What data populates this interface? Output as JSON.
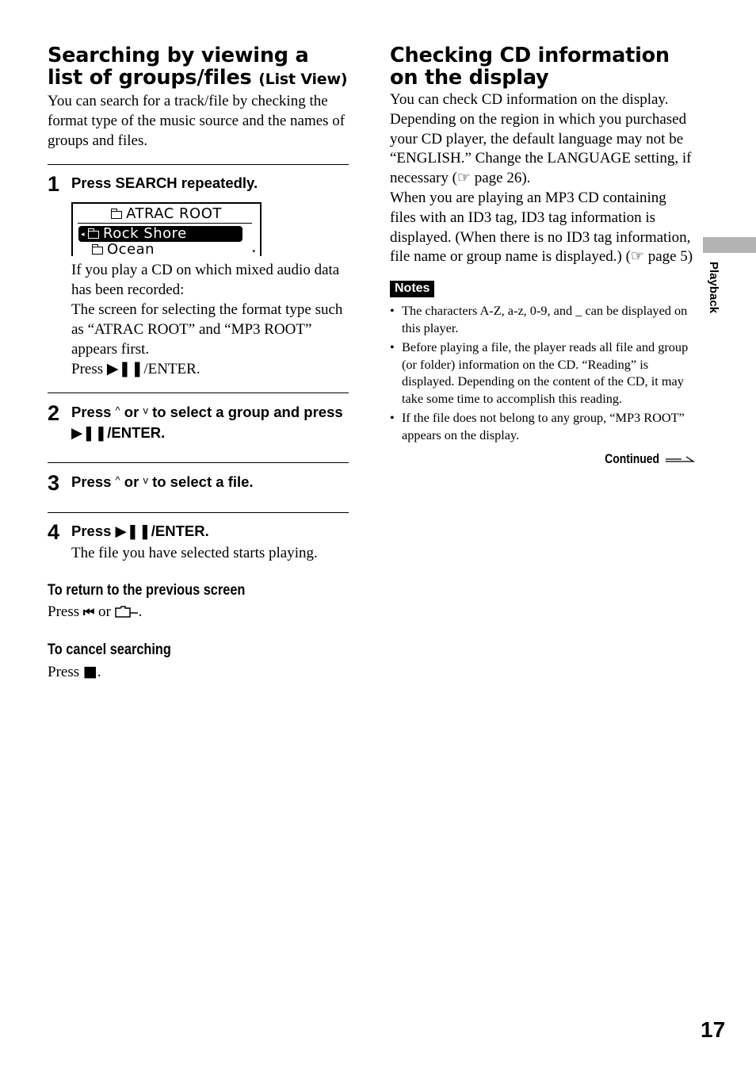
{
  "page_number": "17",
  "side_tab": {
    "label": "Playback",
    "color": "#b3b3b3"
  },
  "left": {
    "title_main": "Searching by viewing a list of groups/files",
    "title_sub": "(List View)",
    "intro": "You can search for a track/file by checking the format type of the music source and the names of groups and files.",
    "steps": [
      {
        "number": "1",
        "title": "Press SEARCH repeatedly.",
        "display": {
          "header": "ATRAC ROOT",
          "selected": "Rock Shore",
          "next": "Ocean"
        },
        "body_lines": [
          "If you play a CD on which mixed audio data has been recorded:",
          "The screen for selecting the format type such as “ATRAC ROOT” and “MP3 ROOT” appears first."
        ],
        "press_prefix": "Press ",
        "press_icon": "▶❚❚",
        "press_suffix": "/ENTER."
      },
      {
        "number": "2",
        "title_a": "Press ",
        "up": "^",
        "title_or": " or ",
        "down": "v",
        "title_b": " to select a group and press ",
        "icon": "▶❚❚",
        "title_c": "/ENTER."
      },
      {
        "number": "3",
        "title_a": "Press ",
        "up": "^",
        "title_or": " or ",
        "down": "v",
        "title_b": " to select a file."
      },
      {
        "number": "4",
        "title_a": "Press ",
        "icon": "▶❚❚",
        "title_b": "/ENTER.",
        "body": "The file you have selected starts playing."
      }
    ],
    "return": {
      "heading": "To return to the previous screen",
      "text_a": "Press ",
      "icon_prev": "⏮",
      "text_or": " or ",
      "text_end": "."
    },
    "cancel": {
      "heading": "To cancel searching",
      "text_a": "Press ",
      "icon_stop": "■",
      "text_end": "."
    }
  },
  "right": {
    "title": "Checking CD information on the display",
    "para1": "You can check CD information on the display. Depending on the region in which you purchased your CD player, the default language may not be “ENGLISH.” Change the LANGUAGE setting, if necessary (☞ page 26).",
    "para2": "When you are playing an MP3 CD containing files with an ID3 tag, ID3 tag information is displayed.  (When there is no ID3 tag information, file name or group name is displayed.) (☞ page 5)",
    "notes_label": "Notes",
    "notes": [
      "The characters A-Z, a-z, 0-9, and _ can be displayed on this player.",
      "Before playing a file, the player reads all file and group (or folder) information on the CD. “Reading” is displayed.  Depending on the content of the CD, it may take some time to accomplish this reading.",
      "If the file does not belong to any group, “MP3 ROOT” appears on the display."
    ],
    "continued": "Continued"
  }
}
